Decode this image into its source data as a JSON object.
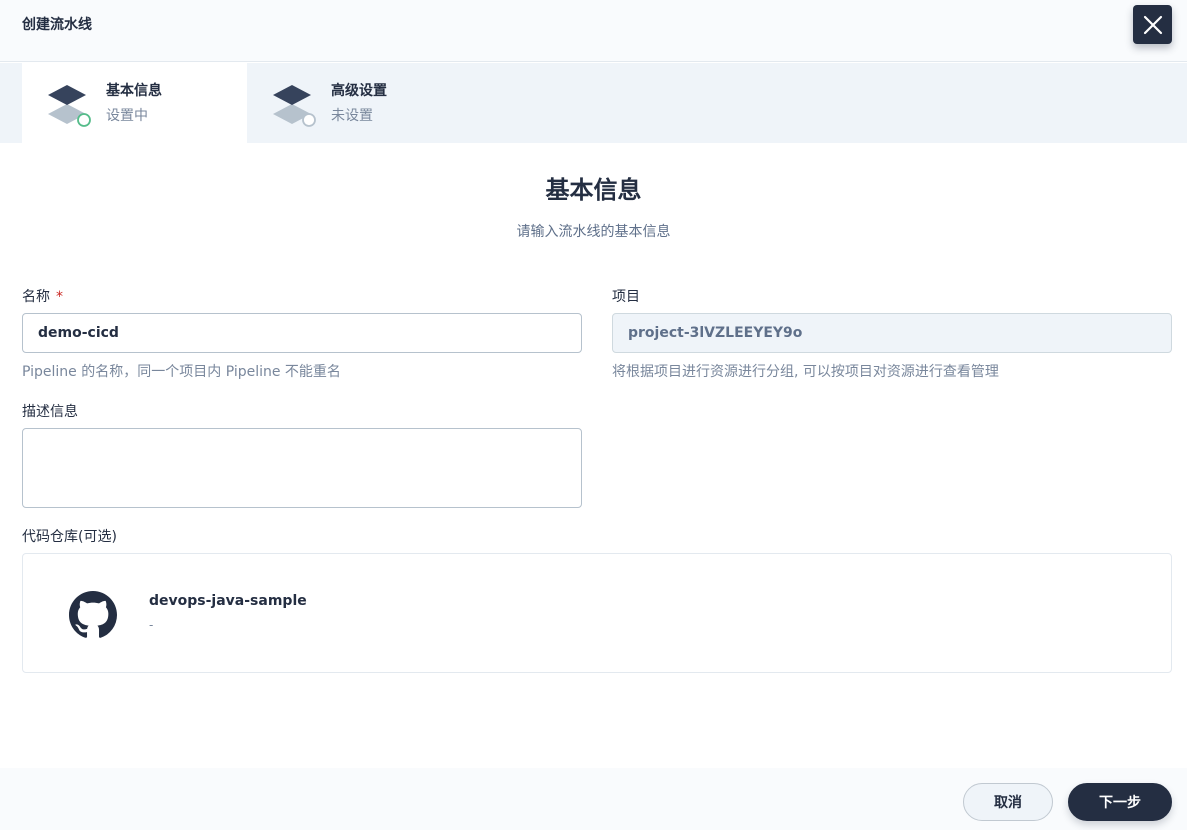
{
  "header": {
    "title": "创建流水线",
    "close_icon": "close-icon"
  },
  "steps": [
    {
      "name": "基本信息",
      "status": "设置中",
      "state": "active"
    },
    {
      "name": "高级设置",
      "status": "未设置",
      "state": "pending"
    }
  ],
  "main": {
    "heading": "基本信息",
    "subheading": "请输入流水线的基本信息"
  },
  "form": {
    "name": {
      "label": "名称",
      "required_mark": "*",
      "value": "demo-cicd",
      "hint": "Pipeline 的名称，同一个项目内 Pipeline 不能重名"
    },
    "project": {
      "label": "项目",
      "value": "project-3lVZLEEYEY9o",
      "hint": "将根据项目进行资源进行分组, 可以按项目对资源进行查看管理"
    },
    "description": {
      "label": "描述信息",
      "value": ""
    },
    "repository": {
      "label": "代码仓库(可选)",
      "icon": "github-icon",
      "name": "devops-java-sample",
      "description": "-"
    }
  },
  "footer": {
    "cancel_label": "取消",
    "next_label": "下一步"
  },
  "colors": {
    "primary": "#242e42",
    "active_ring": "#55bc8a",
    "required": "#ca2621",
    "step_bar": "#eff4f9"
  }
}
